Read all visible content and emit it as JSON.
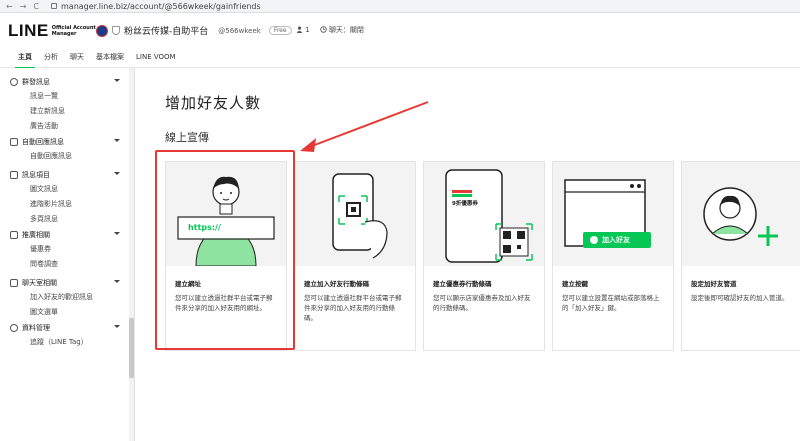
{
  "browser": {
    "url": "manager.line.biz/account/@566wkeek/gainfriends",
    "nav": [
      "←",
      "→",
      "C"
    ]
  },
  "header": {
    "logo_word": "LINE",
    "logo_sub_1": "Official Account",
    "logo_sub_2": "Manager",
    "account_name": "粉丝云传媒-自助平台",
    "account_id": "@566wkeek",
    "plan_badge": "Free",
    "members": "1",
    "chat_status": "聊天：關閉"
  },
  "tabs": [
    "主頁",
    "分析",
    "聊天",
    "基本檔案",
    "LINE VOOM"
  ],
  "sidebar": [
    {
      "label": "群發訊息",
      "icon": "broadcast-icon",
      "children": [
        "訊息一覽",
        "建立新訊息",
        "廣告活動"
      ]
    },
    {
      "label": "自動回應訊息",
      "icon": "reply-icon",
      "children": [
        "自動回應訊息"
      ]
    },
    {
      "label": "訊息項目",
      "icon": "message-item-icon",
      "children": [
        "圖文訊息",
        "進階影片訊息",
        "多頁訊息"
      ]
    },
    {
      "label": "推廣相關",
      "icon": "promotion-icon",
      "children": [
        "優惠券",
        "問卷調查"
      ]
    },
    {
      "label": "聊天室相關",
      "icon": "chatroom-icon",
      "children": [
        "加入好友的歡迎訊息",
        "圖文選單"
      ]
    },
    {
      "label": "資料管理",
      "icon": "data-icon",
      "children": [
        "追蹤（LINE Tag）"
      ]
    }
  ],
  "main": {
    "title": "增加好友人數",
    "section": "線上宣傳",
    "cards": [
      {
        "title": "建立網址",
        "desc": "您可以建立透過社群平台或電子郵件來分享的加入好友用的網址。",
        "thumb_text": "https://"
      },
      {
        "title": "建立加入好友行動條碼",
        "desc": "您可以建立透過社群平台或電子郵件來分享的加入好友用的行動條碼。",
        "thumb_text": ""
      },
      {
        "title": "建立優惠券行動條碼",
        "desc": "您可以顯示店家優惠券及加入好友的行動條碼。",
        "thumb_text": "9折優惠券"
      },
      {
        "title": "建立按鍵",
        "desc": "您可以建立設置在網站或部落格上的「加入好友」鍵。",
        "thumb_text": "加入好友"
      },
      {
        "title": "設定加好友管道",
        "desc": "設定後即可確認好友的加入管道。",
        "thumb_text": ""
      }
    ]
  },
  "colors": {
    "line_green": "#06c755",
    "highlight_red": "#e53935"
  }
}
